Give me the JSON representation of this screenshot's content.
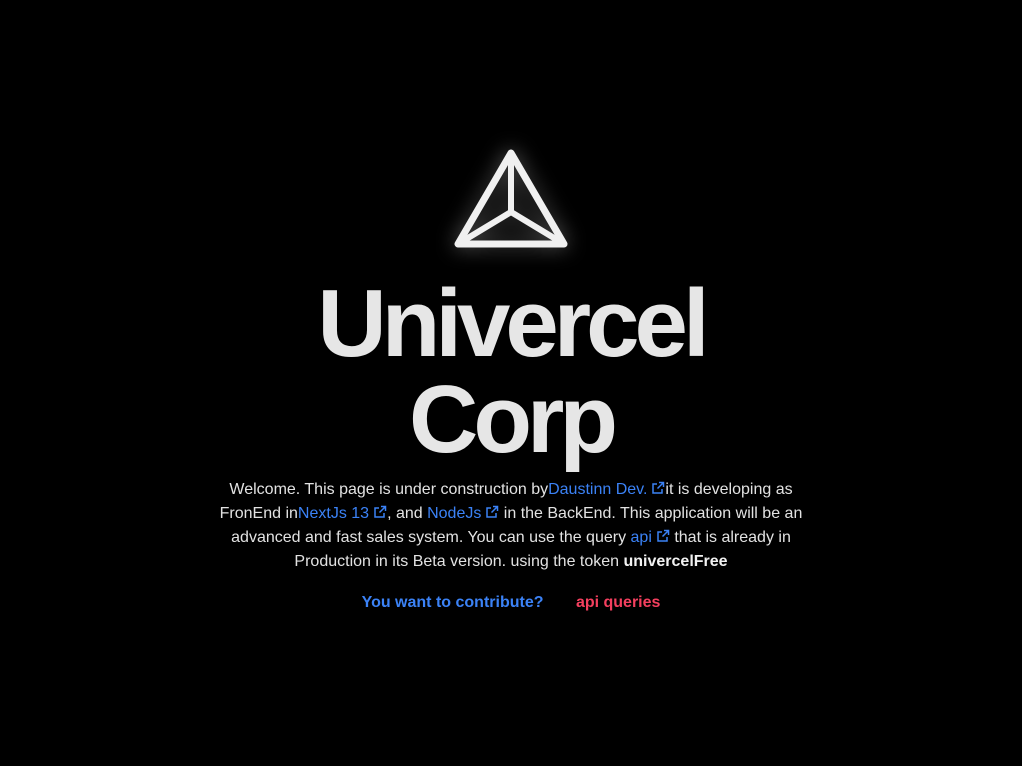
{
  "hero": {
    "title_line1": "Univercel",
    "title_line2": "Corp"
  },
  "intro": {
    "t1": "Welcome. This page is under construction by",
    "link_author": "Daustinn Dev.",
    "t2": "it is developing as FronEnd in",
    "link_next": "NextJs 13",
    "t3": ", and ",
    "link_node": "NodeJs",
    "t4": " in the BackEnd. This application will be an advanced and fast sales system. You can use the query ",
    "link_api": "api",
    "t5": " that is already in Production in its Beta version. using the token ",
    "token": "univercelFree"
  },
  "actions": {
    "contribute_label": "You want to contribute?",
    "api_queries_label": "api queries"
  },
  "icons": {
    "logo": "triangle-logo-icon",
    "external": "external-link-icon"
  },
  "colors": {
    "background": "#000000",
    "text": "#e2e2e2",
    "link": "#3b82f6",
    "accent_red": "#f43f5e"
  }
}
